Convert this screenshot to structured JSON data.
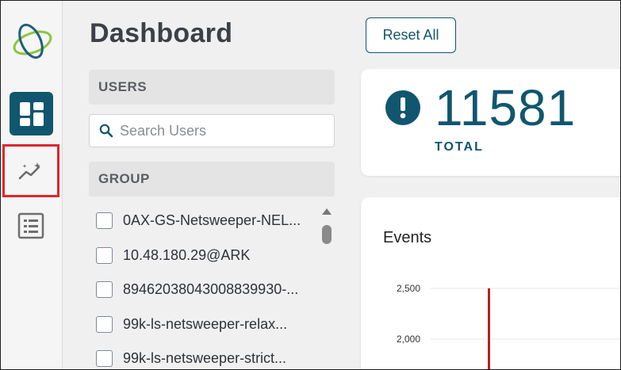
{
  "sidebar": {
    "items": [
      {
        "name": "dashboard",
        "icon": "dashboard-grid-icon",
        "active": true
      },
      {
        "name": "trends",
        "icon": "trend-sparkle-icon",
        "highlighted": true
      },
      {
        "name": "reports",
        "icon": "list-report-icon"
      }
    ]
  },
  "page": {
    "title": "Dashboard"
  },
  "filters": {
    "users_header": "USERS",
    "search": {
      "placeholder": "Search Users",
      "value": ""
    },
    "group_header": "GROUP",
    "groups": [
      "0AX-GS-Netsweeper-NEL...",
      "10.48.180.29@ARK",
      "89462038043008839930-...",
      "99k-ls-netsweeper-relax...",
      "99k-ls-netsweeper-strict..."
    ]
  },
  "toolbar": {
    "reset_label": "Reset All"
  },
  "summary": {
    "total_value": "11581",
    "total_label": "TOTAL",
    "icon": "alert-circle-icon"
  },
  "events": {
    "title": "Events"
  },
  "colors": {
    "accent": "#10566f",
    "highlight": "#e0262d",
    "series": "#b22222"
  },
  "chart_data": {
    "type": "bar",
    "title": "Events",
    "y_ticks": [
      "2,500",
      "2,000"
    ],
    "visible_values": [
      2500
    ]
  }
}
